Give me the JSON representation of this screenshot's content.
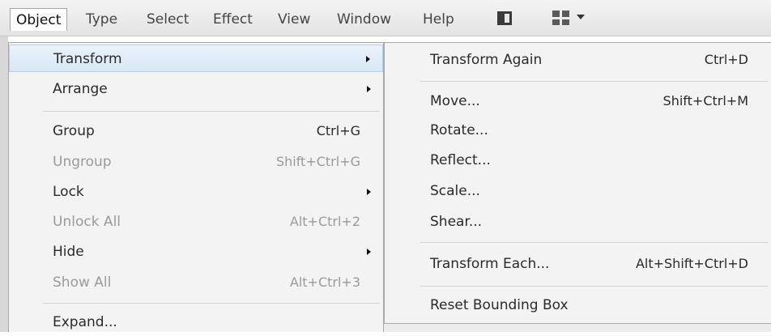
{
  "menubar": {
    "items": [
      "Object",
      "Type",
      "Select",
      "Effect",
      "View",
      "Window",
      "Help"
    ],
    "active": "Object",
    "icons": [
      "panel-toggle-icon",
      "workspace-switcher-icon",
      "chevron-down-icon"
    ]
  },
  "object_menu": {
    "items": [
      {
        "label": "Transform",
        "shortcut": "",
        "submenu": true,
        "disabled": false,
        "highlighted": true
      },
      {
        "label": "Arrange",
        "shortcut": "",
        "submenu": true,
        "disabled": false
      },
      {
        "label": "Group",
        "shortcut": "Ctrl+G",
        "submenu": false,
        "disabled": false
      },
      {
        "label": "Ungroup",
        "shortcut": "Shift+Ctrl+G",
        "submenu": false,
        "disabled": true
      },
      {
        "label": "Lock",
        "shortcut": "",
        "submenu": true,
        "disabled": false
      },
      {
        "label": "Unlock All",
        "shortcut": "Alt+Ctrl+2",
        "submenu": false,
        "disabled": true
      },
      {
        "label": "Hide",
        "shortcut": "",
        "submenu": true,
        "disabled": false
      },
      {
        "label": "Show All",
        "shortcut": "Alt+Ctrl+3",
        "submenu": false,
        "disabled": true
      },
      {
        "label": "Expand...",
        "shortcut": "",
        "submenu": false,
        "disabled": false
      }
    ]
  },
  "transform_submenu": {
    "items": [
      {
        "label": "Transform Again",
        "shortcut": "Ctrl+D"
      },
      {
        "label": "Move...",
        "shortcut": "Shift+Ctrl+M"
      },
      {
        "label": "Rotate...",
        "shortcut": ""
      },
      {
        "label": "Reflect...",
        "shortcut": ""
      },
      {
        "label": "Scale...",
        "shortcut": ""
      },
      {
        "label": "Shear...",
        "shortcut": ""
      },
      {
        "label": "Transform Each...",
        "shortcut": "Alt+Shift+Ctrl+D"
      },
      {
        "label": "Reset Bounding Box",
        "shortcut": ""
      }
    ]
  }
}
